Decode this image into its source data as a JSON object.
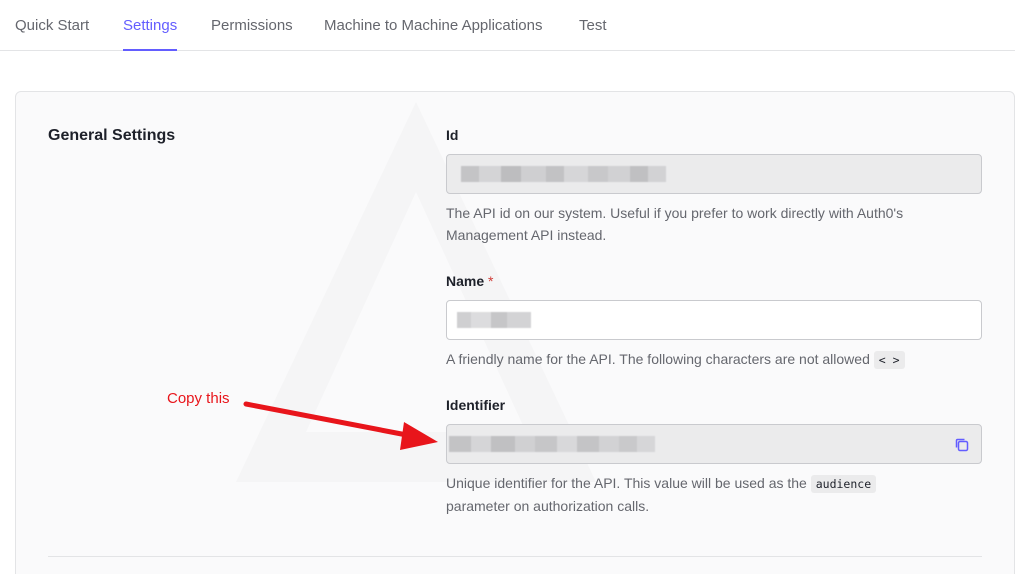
{
  "tabs": [
    {
      "label": "Quick Start",
      "active": false
    },
    {
      "label": "Settings",
      "active": true
    },
    {
      "label": "Permissions",
      "active": false
    },
    {
      "label": "Machine to Machine Applications",
      "active": false
    },
    {
      "label": "Test",
      "active": false
    }
  ],
  "general_settings": {
    "title": "General Settings",
    "id_field": {
      "label": "Id",
      "help": "The API id on our system. Useful if you prefer to work directly with Auth0's Management API instead."
    },
    "name_field": {
      "label": "Name",
      "required_marker": "*",
      "help_prefix": "A friendly name for the API. The following characters are not allowed",
      "disallowed_chars": "< >"
    },
    "identifier_field": {
      "label": "Identifier",
      "help_prefix": "Unique identifier for the API. This value will be used as the",
      "help_code": "audience",
      "help_suffix": "parameter on authorization calls."
    }
  },
  "annotation": {
    "text": "Copy this",
    "color": "#e8151b"
  },
  "colors": {
    "accent": "#635dff",
    "required": "#d03c38",
    "text": "#1e212a",
    "muted": "#65676e"
  },
  "icons": {
    "copy": "copy-icon"
  }
}
